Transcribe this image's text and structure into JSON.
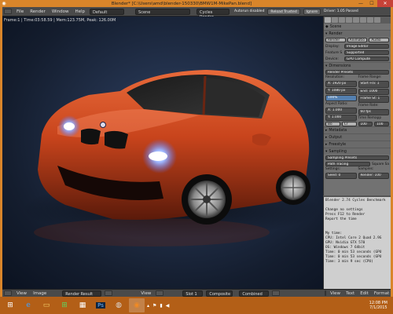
{
  "window": {
    "title": "Blender* [C:\\Users\\amd\\blender-150330\\BMW1M-MikePan.blend]",
    "minimize": "—",
    "maximize": "☐",
    "close": "✕"
  },
  "header": {
    "menus": [
      "File",
      "Render",
      "Window",
      "Help"
    ],
    "layout": "Default",
    "scene": "Scene",
    "engine": "Cycles Render",
    "autorun": "Autorun disabled",
    "reload_trusted": "Reload Trusted",
    "ignore": "Ignore",
    "driver": "Driver: 1.05 Passed"
  },
  "viewport": {
    "stats": "Frame:1 | Time:03:58.59 | Mem:123.75M, Peak: 126.00M"
  },
  "viewer_footer": {
    "view": "View",
    "image": "Image",
    "image_name": "Render Result",
    "slot": "Slot 1",
    "pass": "Composite",
    "combined": "Combined"
  },
  "props": {
    "breadcrumb": "Scene",
    "render_section": "Render",
    "render_btn": "Render",
    "animation_btn": "Animatio",
    "audio_btn": "Audio",
    "display_label": "Display:",
    "display_value": "Image Editor",
    "feature_label": "Feature S",
    "feature_value": "Supported",
    "device_label": "Device:",
    "device_value": "GPU Compute",
    "dimensions_section": "Dimensions",
    "render_presets": "Render Presets",
    "resolution_label": "Resolution:",
    "res_x": "X: 1920 px",
    "res_y": "Y: 1080 px",
    "res_pct": "100%",
    "frame_range_label": "Frame Range:",
    "start_frame": "Start Fra: 1",
    "end_frame": "End: 1000",
    "frame_step": "Frame St: 1",
    "aspect_label": "Aspect Ratio:",
    "aspect_x": "X: 1.000",
    "aspect_y": "Y: 1.000",
    "frame_rate_label": "Frame Rate:",
    "frame_rate": "60 fps",
    "time_remap_label": "Time Remapp",
    "remap_old": "100",
    "remap_new": "100",
    "border": "Bo",
    "crop": "Cr",
    "metadata_section": "Metadata",
    "output_section": "Output",
    "freestyle_section": "Freestyle",
    "sampling_section": "Sampling",
    "sampling_presets": "Sampling Presets",
    "path_tracing": "Path Tracing",
    "square_samples": "Square Sa",
    "settings_label": "Settings:",
    "samples_label": "Samples:",
    "seed": "Seed: 0",
    "render_samples": "Render: 100"
  },
  "text_editor": {
    "lines": [
      "Blender 2.74 Cycles Benchmark",
      "",
      "Change no settings",
      "Press F12 to Render",
      "Report the time",
      "",
      "",
      "My time:",
      "CPU: Intel Core 2 Quad 2.9G",
      "GPU: Nvidia GTX 570",
      "OS: Windows 7 64bit",
      "Time: 0 min 53 seconds (GPU",
      "Time: 0 min 53 seconds (GPU",
      "Time: 3 min 9 sec (CPU)"
    ],
    "footer": [
      "View",
      "Text",
      "Edit",
      "Format"
    ]
  },
  "taskbar": {
    "time": "12:08 PM",
    "date": "7/1/2015"
  },
  "colors": {
    "accent": "#d9852a",
    "taskbar": "#b35f17",
    "car_body": "#c8441c"
  }
}
